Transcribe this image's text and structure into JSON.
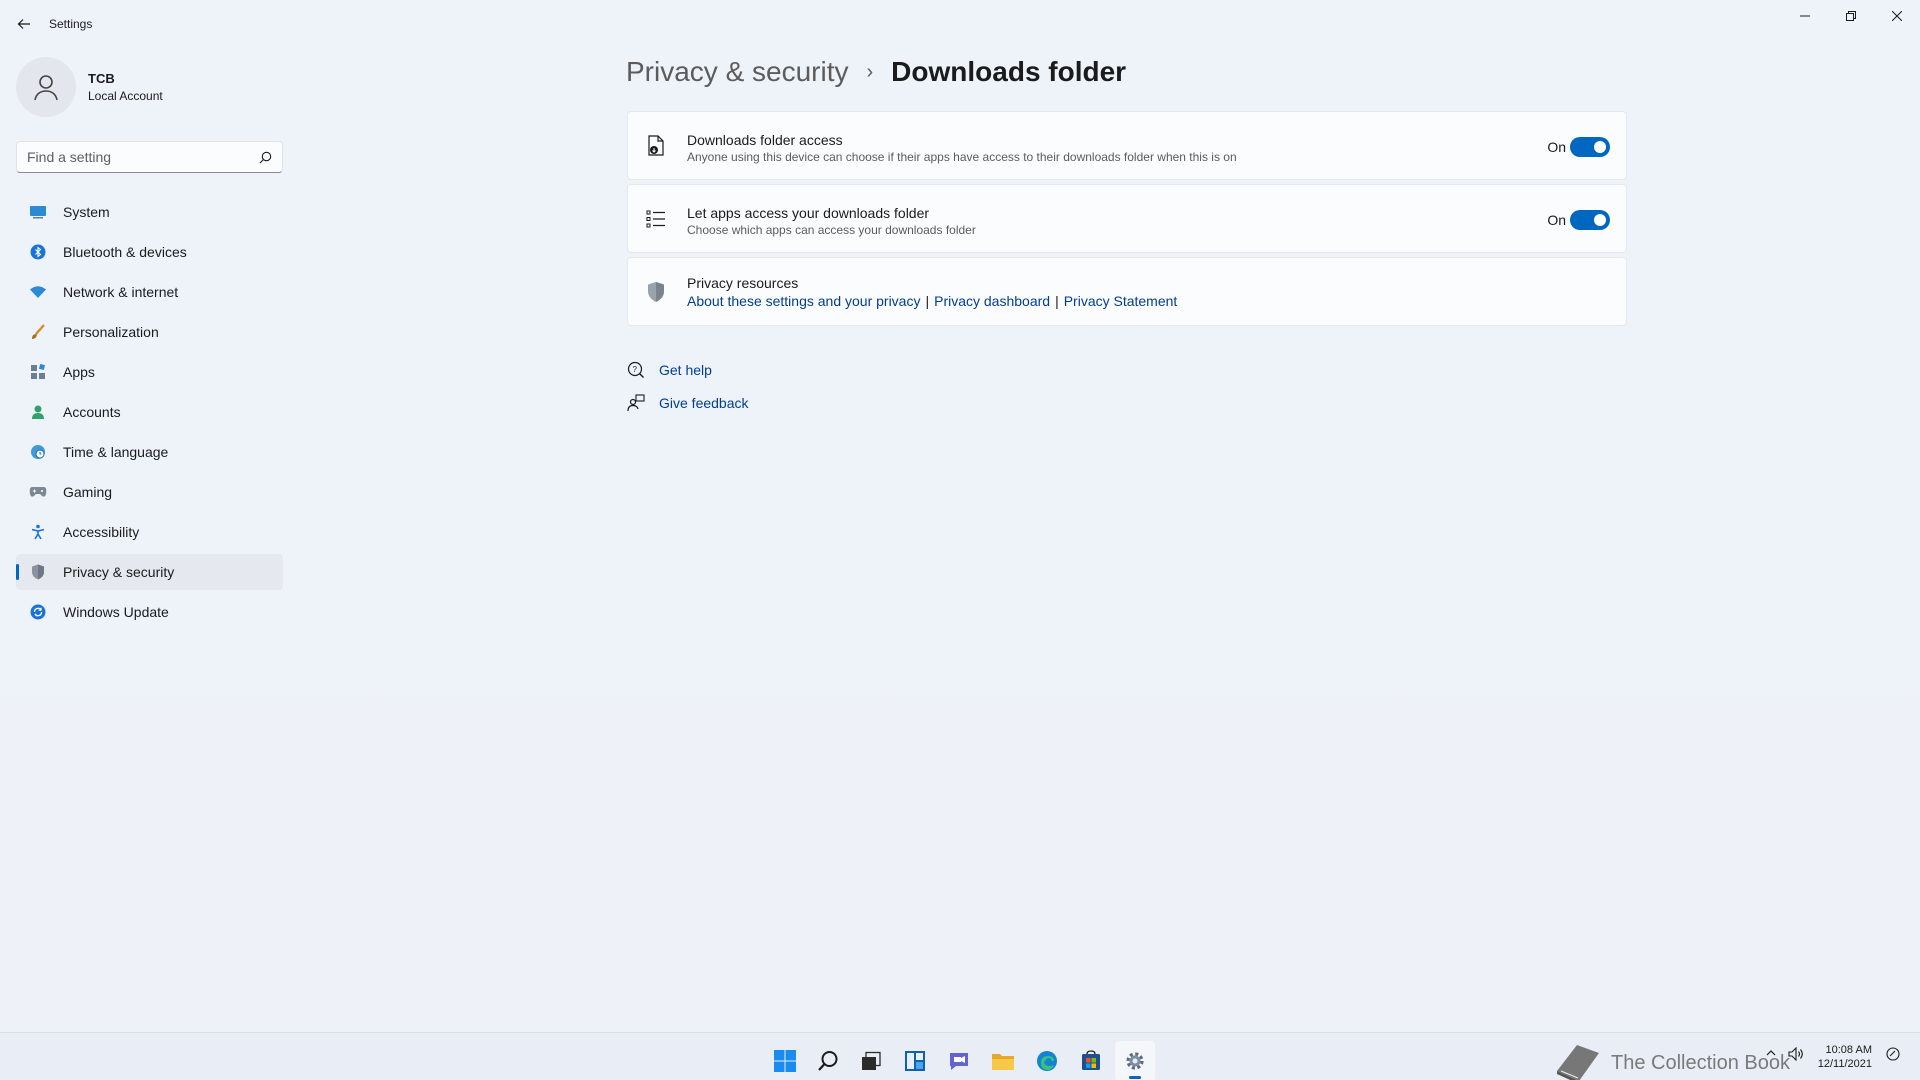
{
  "window": {
    "app_title": "Settings"
  },
  "profile": {
    "name": "TCB",
    "account_type": "Local Account"
  },
  "search": {
    "placeholder": "Find a setting",
    "value": ""
  },
  "sidebar": {
    "items": [
      {
        "label": "System",
        "icon": "system-icon",
        "active": false
      },
      {
        "label": "Bluetooth & devices",
        "icon": "bluetooth-icon",
        "active": false
      },
      {
        "label": "Network & internet",
        "icon": "wifi-icon",
        "active": false
      },
      {
        "label": "Personalization",
        "icon": "brush-icon",
        "active": false
      },
      {
        "label": "Apps",
        "icon": "apps-icon",
        "active": false
      },
      {
        "label": "Accounts",
        "icon": "person-icon",
        "active": false
      },
      {
        "label": "Time & language",
        "icon": "globe-clock-icon",
        "active": false
      },
      {
        "label": "Gaming",
        "icon": "gamepad-icon",
        "active": false
      },
      {
        "label": "Accessibility",
        "icon": "accessibility-icon",
        "active": false
      },
      {
        "label": "Privacy & security",
        "icon": "shield-icon",
        "active": true
      },
      {
        "label": "Windows Update",
        "icon": "update-icon",
        "active": false
      }
    ]
  },
  "breadcrumb": {
    "parent": "Privacy & security",
    "separator": "›",
    "current": "Downloads folder"
  },
  "settings": {
    "downloads_access": {
      "title": "Downloads folder access",
      "description": "Anyone using this device can choose if their apps have access to their downloads folder when this is on",
      "state_label": "On",
      "enabled": true
    },
    "apps_access": {
      "title": "Let apps access your downloads folder",
      "description": "Choose which apps can access your downloads folder",
      "state_label": "On",
      "enabled": true
    },
    "privacy_resources": {
      "title": "Privacy resources",
      "links": [
        "About these settings and your privacy",
        "Privacy dashboard",
        "Privacy Statement"
      ],
      "separator": "|"
    }
  },
  "help": {
    "get_help": "Get help",
    "give_feedback": "Give feedback"
  },
  "taskbar": {
    "time": "10:08 AM",
    "date": "12/11/2021",
    "watermark": "The Collection Book",
    "colors": {
      "accent": "#0067c0"
    }
  }
}
